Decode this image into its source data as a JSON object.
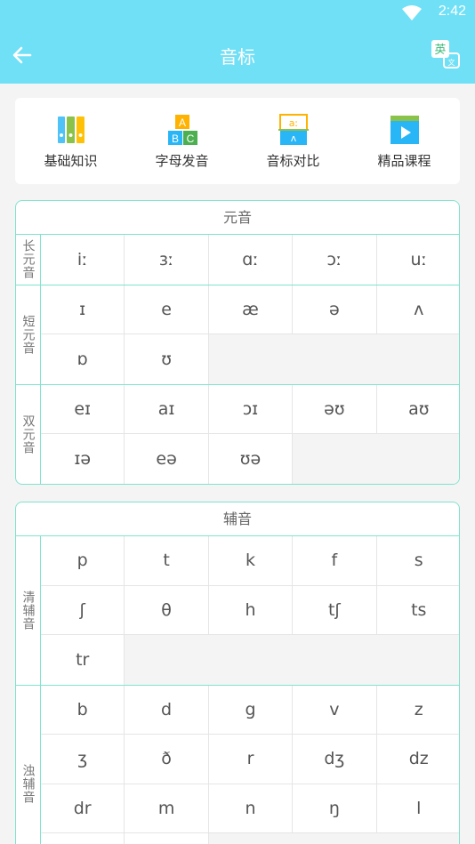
{
  "status": {
    "time": "2:42"
  },
  "header": {
    "title": "音标",
    "translate_badge": "英"
  },
  "quick": [
    {
      "label": "基础知识",
      "icon": "binders-icon"
    },
    {
      "label": "字母发音",
      "icon": "abc-blocks-icon"
    },
    {
      "label": "音标对比",
      "icon": "compare-icon"
    },
    {
      "label": "精品课程",
      "icon": "video-icon"
    }
  ],
  "vowels": {
    "title": "元音",
    "groups": [
      {
        "label": "长元音",
        "rows": [
          [
            "iː",
            "ɜː",
            "ɑː",
            "ɔː",
            "uː"
          ]
        ]
      },
      {
        "label": "短元音",
        "rows": [
          [
            "ɪ",
            "e",
            "æ",
            "ə",
            "ʌ"
          ],
          [
            "ɒ",
            "ʊ"
          ]
        ]
      },
      {
        "label": "双元音",
        "rows": [
          [
            "eɪ",
            "aɪ",
            "ɔɪ",
            "əʊ",
            "aʊ"
          ],
          [
            "ɪə",
            "eə",
            "ʊə"
          ]
        ]
      }
    ]
  },
  "consonants": {
    "title": "辅音",
    "groups": [
      {
        "label": "清辅音",
        "rows": [
          [
            "p",
            "t",
            "k",
            "f",
            "s"
          ],
          [
            "ʃ",
            "θ",
            "h",
            "tʃ",
            "ts"
          ],
          [
            "tr"
          ]
        ]
      },
      {
        "label": "浊辅音",
        "rows": [
          [
            "b",
            "d",
            "g",
            "v",
            "z"
          ],
          [
            "ʒ",
            "ð",
            "r",
            "dʒ",
            "dz"
          ],
          [
            "dr",
            "m",
            "n",
            "ŋ",
            "l"
          ],
          [
            "",
            ""
          ]
        ]
      }
    ]
  }
}
